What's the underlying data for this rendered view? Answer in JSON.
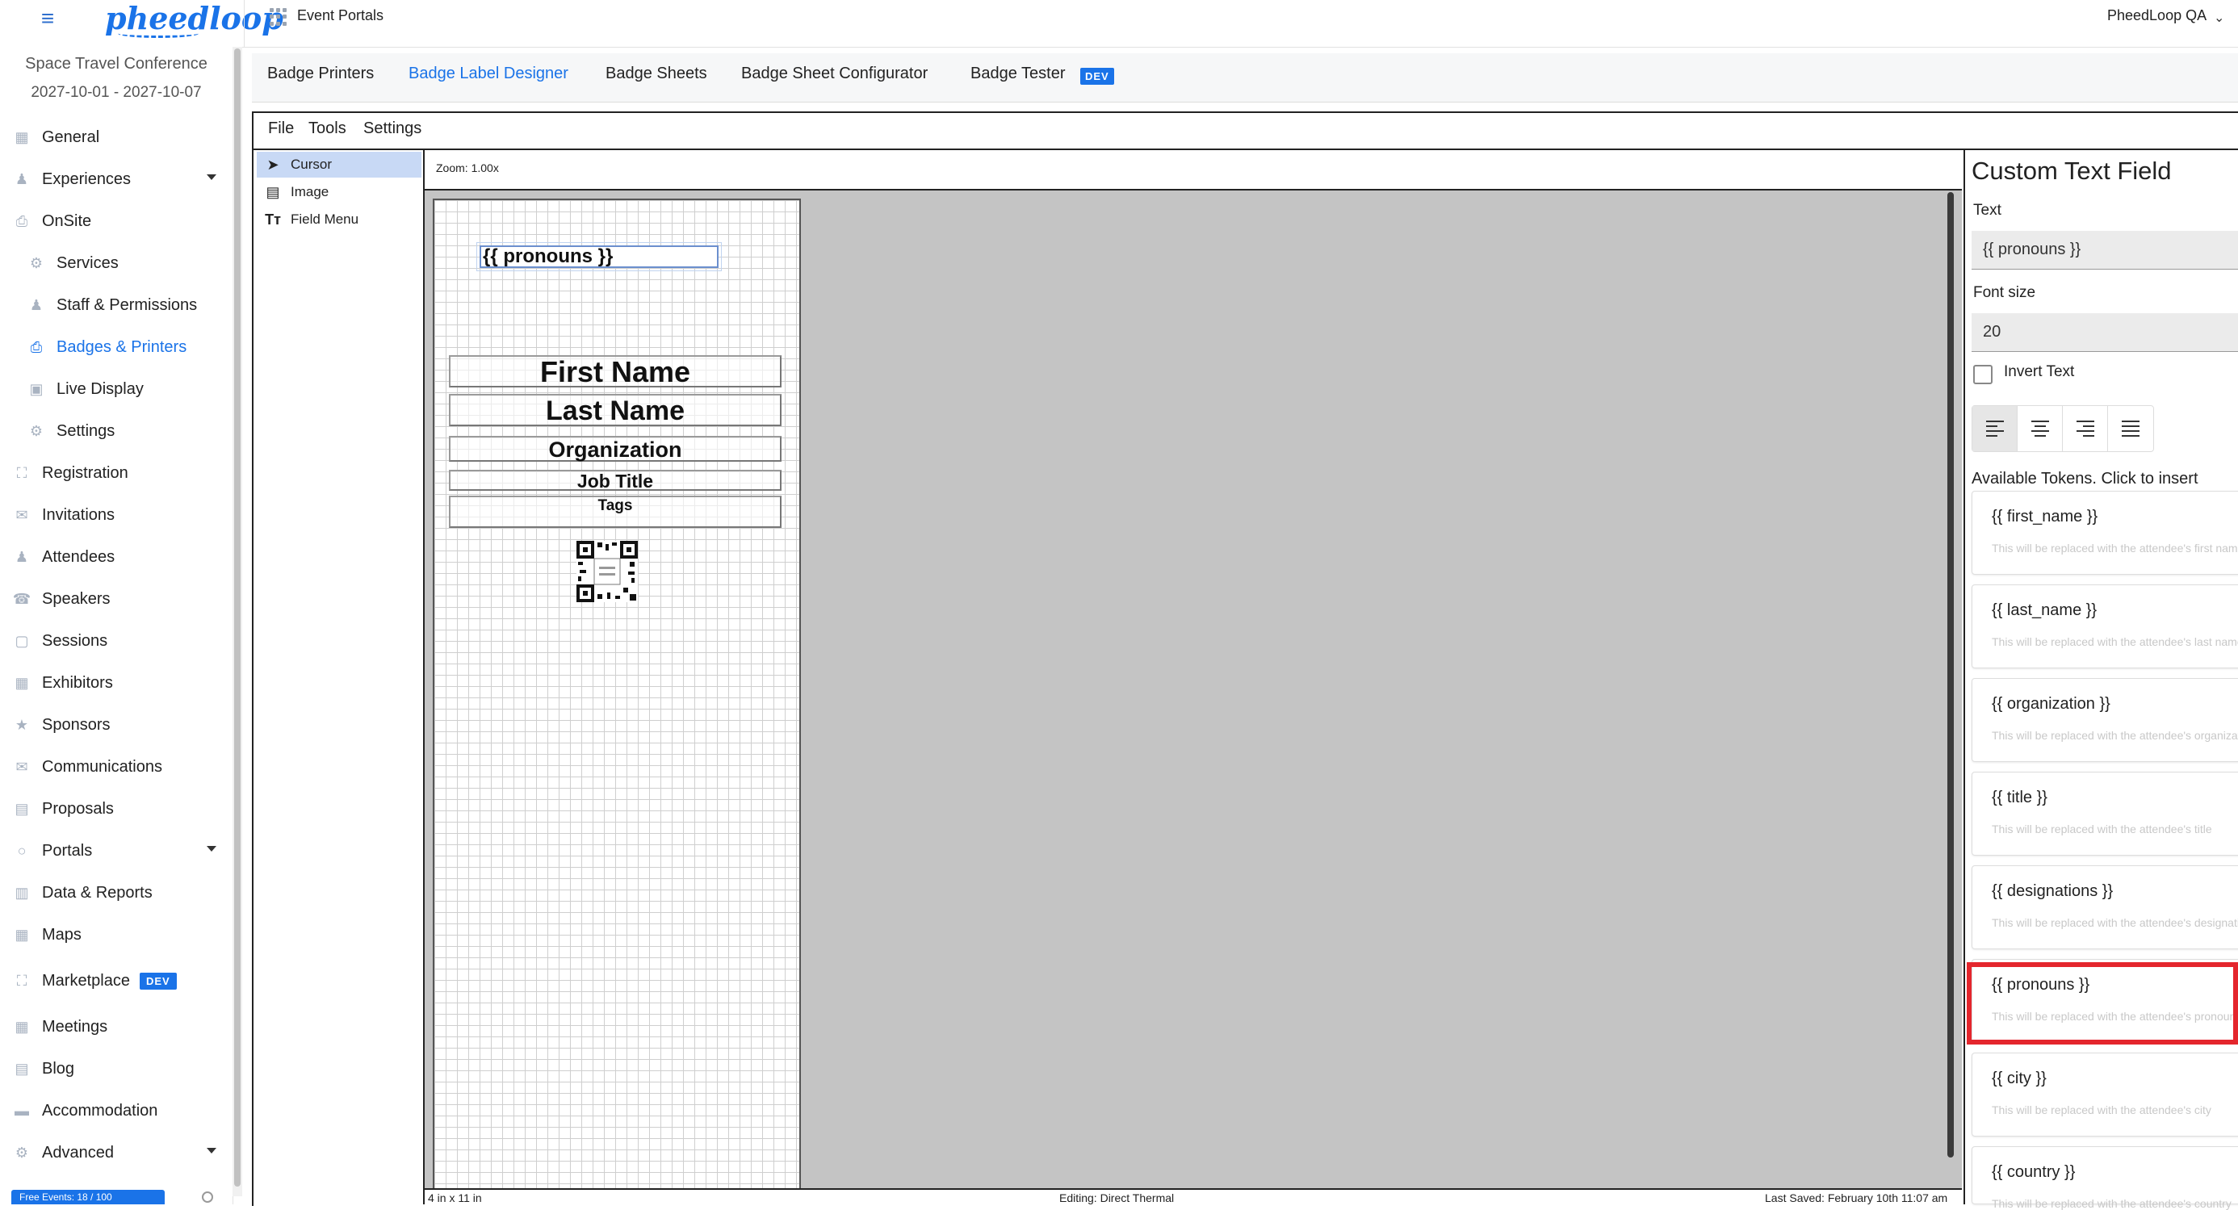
{
  "header": {
    "logo_text": "pheedloop",
    "portal_link": "Event Portals",
    "account": "PheedLoop QA"
  },
  "sidebar": {
    "event_name": "Space Travel Conference",
    "event_dates": "2027-10-01 - 2027-10-07",
    "items": [
      {
        "label": "General"
      },
      {
        "label": "Experiences"
      },
      {
        "label": "OnSite"
      },
      {
        "label": "Services"
      },
      {
        "label": "Staff & Permissions"
      },
      {
        "label": "Badges & Printers"
      },
      {
        "label": "Live Display"
      },
      {
        "label": "Settings"
      },
      {
        "label": "Registration"
      },
      {
        "label": "Invitations"
      },
      {
        "label": "Attendees"
      },
      {
        "label": "Speakers"
      },
      {
        "label": "Sessions"
      },
      {
        "label": "Exhibitors"
      },
      {
        "label": "Sponsors"
      },
      {
        "label": "Communications"
      },
      {
        "label": "Proposals"
      },
      {
        "label": "Portals"
      },
      {
        "label": "Data & Reports"
      },
      {
        "label": "Maps"
      },
      {
        "label": "Marketplace"
      },
      {
        "label": "Meetings"
      },
      {
        "label": "Blog"
      },
      {
        "label": "Accommodation"
      },
      {
        "label": "Advanced"
      }
    ],
    "dev_badge": "DEV",
    "bottom_bar": "Free Events: 18 / 100"
  },
  "tabs": {
    "items": [
      {
        "label": "Badge Printers"
      },
      {
        "label": "Badge Label Designer"
      },
      {
        "label": "Badge Sheets"
      },
      {
        "label": "Badge Sheet Configurator"
      },
      {
        "label": "Badge Tester"
      }
    ],
    "dev_badge": "DEV",
    "active": "Badge Label Designer"
  },
  "designer": {
    "menus": [
      "File",
      "Tools",
      "Settings"
    ],
    "tools": [
      {
        "label": "Cursor"
      },
      {
        "label": "Image"
      },
      {
        "label": "Field Menu"
      }
    ],
    "zoom": "Zoom: 1.00x",
    "fields": {
      "pronouns": "{{ pronouns }}",
      "first_name": "First Name",
      "last_name": "Last Name",
      "organization": "Organization",
      "job_title": "Job Title",
      "tags": "Tags"
    },
    "status": {
      "size": "4 in x 11 in",
      "editing": "Editing: Direct Thermal",
      "saved": "Last Saved: February 10th 11:07 am"
    }
  },
  "panel": {
    "title": "Custom Text Field",
    "text_label": "Text",
    "text_value": "{{ pronouns }}",
    "font_size_label": "Font size",
    "font_size_value": "20",
    "invert_label": "Invert Text",
    "tokens_label": "Available Tokens. Click to insert",
    "tokens": [
      {
        "name": "{{ first_name }}",
        "desc": "This will be replaced with the attendee's first name"
      },
      {
        "name": "{{ last_name }}",
        "desc": "This will be replaced with the attendee's last name"
      },
      {
        "name": "{{ organization }}",
        "desc": "This will be replaced with the attendee's organization"
      },
      {
        "name": "{{ title }}",
        "desc": "This will be replaced with the attendee's title"
      },
      {
        "name": "{{ designations }}",
        "desc": "This will be replaced with the attendee's designations"
      },
      {
        "name": "{{ pronouns }}",
        "desc": "This will be replaced with the attendee's pronouns"
      },
      {
        "name": "{{ city }}",
        "desc": "This will be replaced with the attendee's city"
      },
      {
        "name": "{{ country }}",
        "desc": "This will be replaced with the attendee's country"
      }
    ]
  },
  "colors": {
    "accent": "#1a73e8",
    "highlight": "#e4262d",
    "canvas_bg": "#c4c4c4"
  }
}
